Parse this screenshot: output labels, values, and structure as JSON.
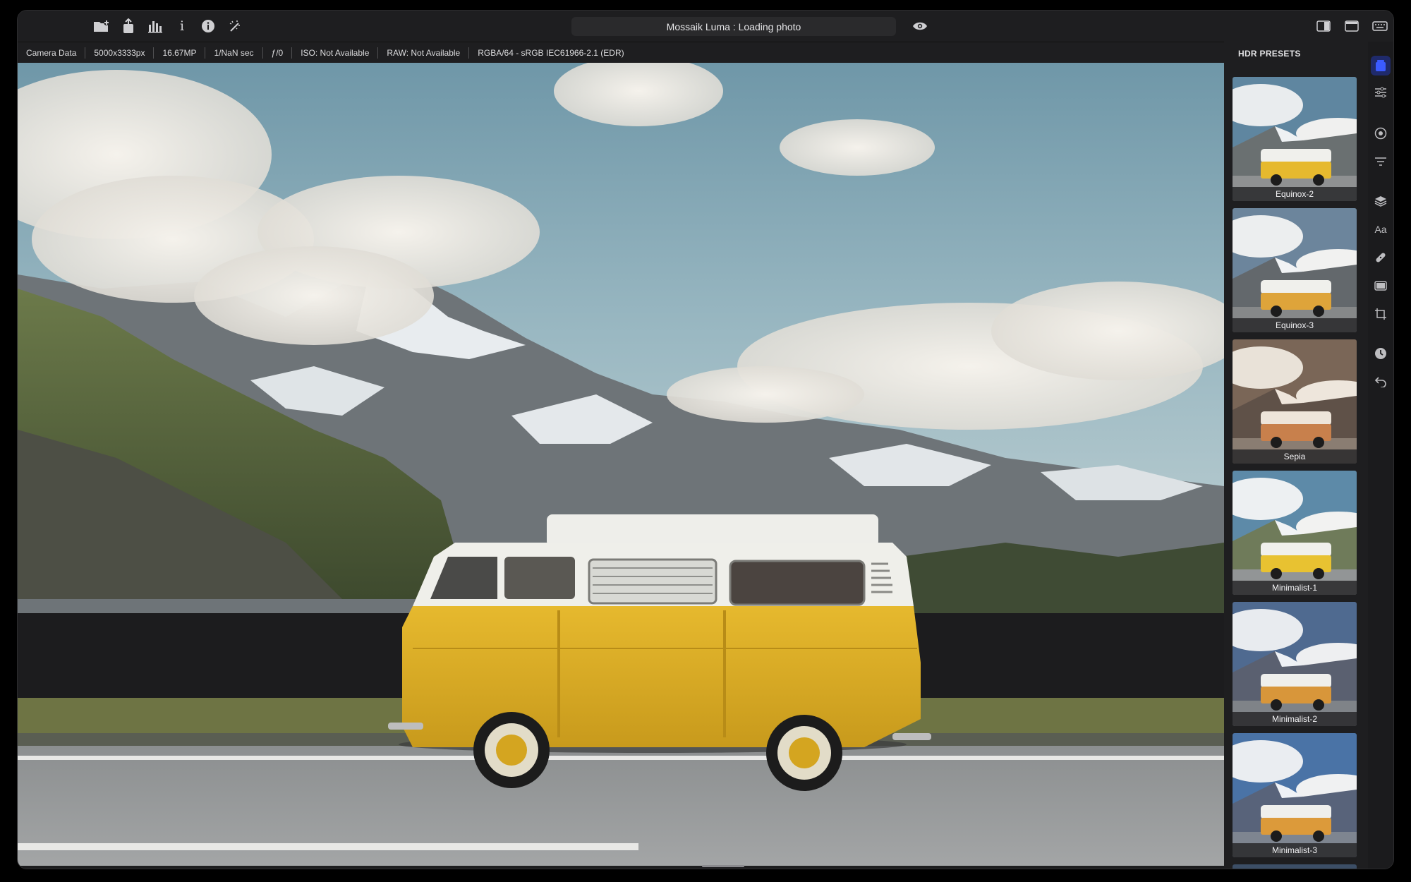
{
  "window": {
    "title": "Mossaik Luma : Loading photo"
  },
  "toolbar": {
    "left_icons": [
      "open-folder-icon",
      "share-icon",
      "histogram-icon",
      "info-i-icon",
      "info-circle-icon",
      "magic-wand-icon"
    ],
    "preview_icon": "eye-icon",
    "right_icons": [
      "sidebar-toggle-icon",
      "single-view-icon",
      "keyboard-icon"
    ]
  },
  "info_bar": {
    "items": [
      "Camera Data",
      "5000x3333px",
      "16.67MP",
      "1/NaN sec",
      "ƒ/0",
      "ISO: Not Available",
      "RAW: Not Available",
      "RGBA/64 - sRGB IEC61966-2.1 (EDR)"
    ]
  },
  "presets": {
    "header": "HDR PRESETS",
    "items": [
      {
        "label": "Equinox-2",
        "tint": "#3d5a72"
      },
      {
        "label": "Equinox-3",
        "tint": "#4a5a70"
      },
      {
        "label": "Sepia",
        "tint": "#6b5140"
      },
      {
        "label": "Minimalist-1",
        "tint": "#4f6a80"
      },
      {
        "label": "Minimalist-2",
        "tint": "#45577a"
      },
      {
        "label": "Minimalist-3",
        "tint": "#3f5f86"
      }
    ]
  },
  "tool_rail": {
    "icons": [
      "presets-icon",
      "sliders-icon",
      "target-icon",
      "filter-lines-icon",
      "layers-icon",
      "text-icon",
      "bandage-icon",
      "frame-icon",
      "crop-icon",
      "history-icon",
      "undo-icon"
    ],
    "text_icon_glyph": "Aa",
    "active_color": "#3b5bff"
  },
  "colors": {
    "van_yellow": "#e2b32a",
    "sky": "#7fa3b4",
    "background": "#1c1c1e"
  }
}
